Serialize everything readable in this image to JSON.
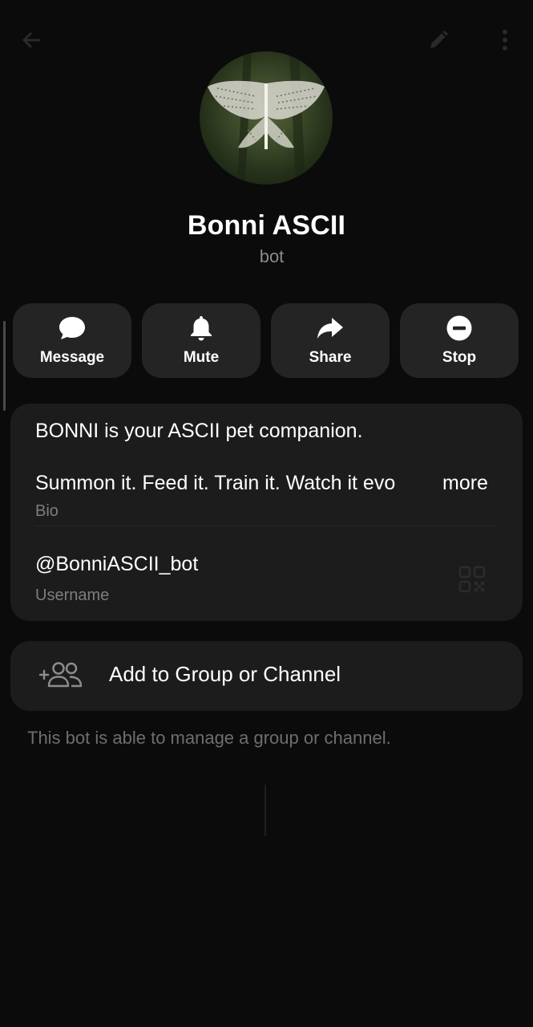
{
  "header": {
    "back_icon": "arrow-left-icon",
    "edit_icon": "pencil-icon",
    "more_icon": "kebab-menu-icon"
  },
  "profile": {
    "name": "Bonni ASCII",
    "status": "bot",
    "avatar_icon": "ascii-butterfly-avatar"
  },
  "actions": [
    {
      "label": "Message",
      "icon": "chat-bubble-icon"
    },
    {
      "label": "Mute",
      "icon": "bell-icon"
    },
    {
      "label": "Share",
      "icon": "share-arrow-icon"
    },
    {
      "label": "Stop",
      "icon": "minus-circle-icon"
    }
  ],
  "info": {
    "bio_line_1": "BONNI is your ASCII pet companion.",
    "bio_line_2": "Summon it. Feed it. Train it. Watch it evo",
    "bio_more": "more",
    "bio_caption": "Bio",
    "username": "@BonniASCII_bot",
    "username_caption": "Username",
    "qr_icon": "qr-code-icon"
  },
  "add_to_group": {
    "label": "Add to Group or Channel",
    "icon": "add-users-icon"
  },
  "footer_note": "This bot is able to manage a group or channel.",
  "colors": {
    "background": "#0b0b0b",
    "button_bg": "#242424",
    "card_bg": "#1c1c1c",
    "secondary_text": "#7d7d7d"
  }
}
